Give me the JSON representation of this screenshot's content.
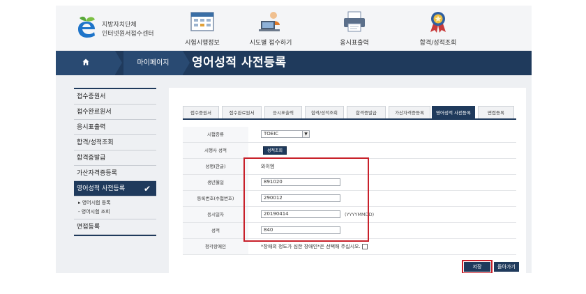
{
  "header": {
    "logo_line1": "지방자치단체",
    "logo_line2": "인터넷원서접수센터",
    "nav": [
      {
        "label": "시험시행정보",
        "icon": "calendar-icon"
      },
      {
        "label": "시도별 접수하기",
        "icon": "person-laptop-icon"
      },
      {
        "label": "응시표출력",
        "icon": "printer-icon"
      },
      {
        "label": "합격/성적조회",
        "icon": "medal-icon"
      }
    ]
  },
  "titlebar": {
    "breadcrumb": "마이페이지",
    "page_title": "영어성적 사전등록"
  },
  "sidebar": {
    "items": [
      {
        "label": "접수중원서"
      },
      {
        "label": "접수완료원서"
      },
      {
        "label": "응시표출력"
      },
      {
        "label": "합격/성적조회"
      },
      {
        "label": "합격증발급"
      },
      {
        "label": "가산자격증등록"
      },
      {
        "label": "영어성적 사전등록",
        "active": true
      }
    ],
    "subitems": [
      "▸ 영어시험 등록",
      "- 영어시험 조회"
    ],
    "last_item": "면접등록"
  },
  "tabs": [
    {
      "label": "접수중원서"
    },
    {
      "label": "접수완료원서"
    },
    {
      "label": "응시표출력"
    },
    {
      "label": "합격/성적조회"
    },
    {
      "label": "합격증발급"
    },
    {
      "label": "가산자격증등록"
    },
    {
      "label": "영어성적 사전등록",
      "active": true
    },
    {
      "label": "면접등록"
    }
  ],
  "form": {
    "exam_type_label": "시험종류",
    "exam_type_value": "TOEIC",
    "exam_score_label": "시행사 성적",
    "exam_score_button": "성적조회",
    "name_label": "성명(한글)",
    "name_value": "와이엠",
    "birth_label": "생년월일",
    "birth_value": "891020",
    "regno_label": "등록번호(수험번호)",
    "regno_value": "290012",
    "testdate_label": "응시일자",
    "testdate_value": "20190414",
    "testdate_hint": "(YYYYMMDD)",
    "score_label": "성적",
    "score_value": "840",
    "disability_label": "청각장애인",
    "disability_hint": "*장애의 정도가 심한 장애인*은 선택해 주십시오."
  },
  "actions": {
    "save": "저장",
    "back": "돌아가기"
  },
  "colors": {
    "navy": "#1f3a5c",
    "highlight_red": "#c8202a"
  }
}
